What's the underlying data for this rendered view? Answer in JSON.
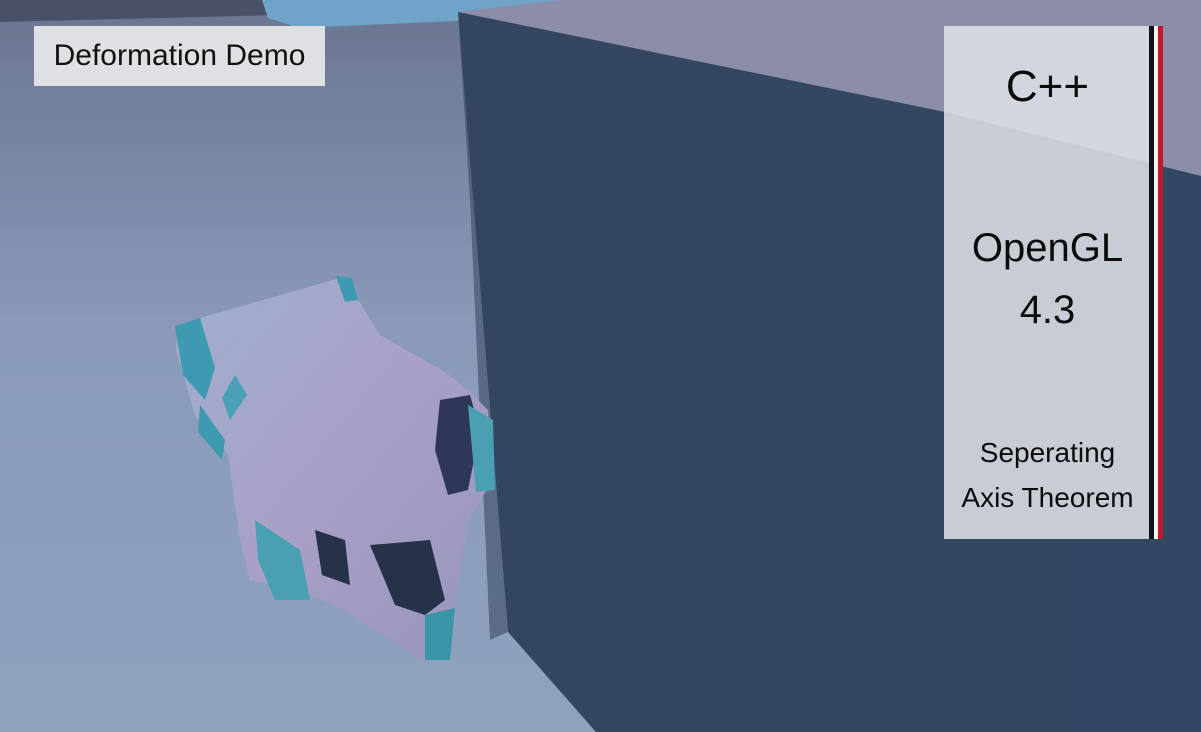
{
  "overlay": {
    "title": "Deformation Demo",
    "panel": {
      "language": "C++",
      "api_name": "OpenGL",
      "api_version": "4.3",
      "algorithm_line1": "Seperating",
      "algorithm_line2": "Axis Theorem"
    }
  },
  "colors": {
    "floor": "#8a9bb6",
    "cube_front": "#364a64",
    "cube_top": "#8a8ca6",
    "car_body": "#a9a4c4",
    "car_accent": "#3a95a8",
    "panel_stripe_red": "#c01828"
  }
}
